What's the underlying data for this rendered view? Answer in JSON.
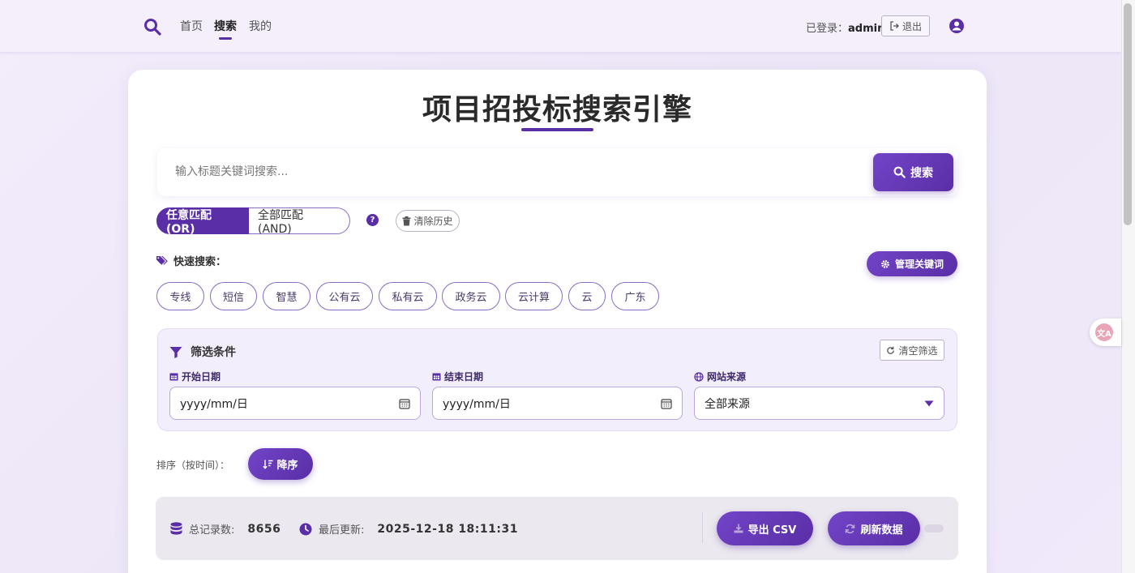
{
  "nav": {
    "links": [
      "首页",
      "搜索",
      "我的"
    ],
    "login_prefix": "已登录：",
    "username": "admin",
    "logout_label": "退出"
  },
  "page": {
    "title": "项目招投标搜索引擎"
  },
  "search": {
    "placeholder": "输入标题关键词搜索...",
    "button_label": "搜索"
  },
  "match_mode": {
    "any_label": "任意匹配 (OR)",
    "all_label": "全部匹配 (AND)",
    "selected": "any",
    "help_glyph": "?",
    "clear_history_label": "清除历史"
  },
  "quick_search": {
    "label": "快速搜索：",
    "manage_label": "管理关键词",
    "chips": [
      "专线",
      "短信",
      "智慧",
      "公有云",
      "私有云",
      "政务云",
      "云计算",
      "云",
      "广东"
    ]
  },
  "filters": {
    "title": "筛选条件",
    "reset_label": "清空筛选",
    "start_date_label": "开始日期",
    "start_date_value": "yyyy/mm/日",
    "end_date_label": "结束日期",
    "end_date_value": "yyyy/mm/日",
    "source_label": "网站来源",
    "source_value": "全部来源"
  },
  "sort": {
    "label": "排序（按时间）：",
    "button_label": "降序"
  },
  "stats": {
    "total_label": "总记录数:",
    "total_value": "8656",
    "updated_label": "最后更新:",
    "updated_value": "2025-12-18 18:11:31",
    "export_label": "导出 CSV",
    "refresh_label": "刷新数据"
  },
  "colors": {
    "accent": "#5a2ea6",
    "accent_light": "#7244c8",
    "background": "#efe9fa"
  }
}
